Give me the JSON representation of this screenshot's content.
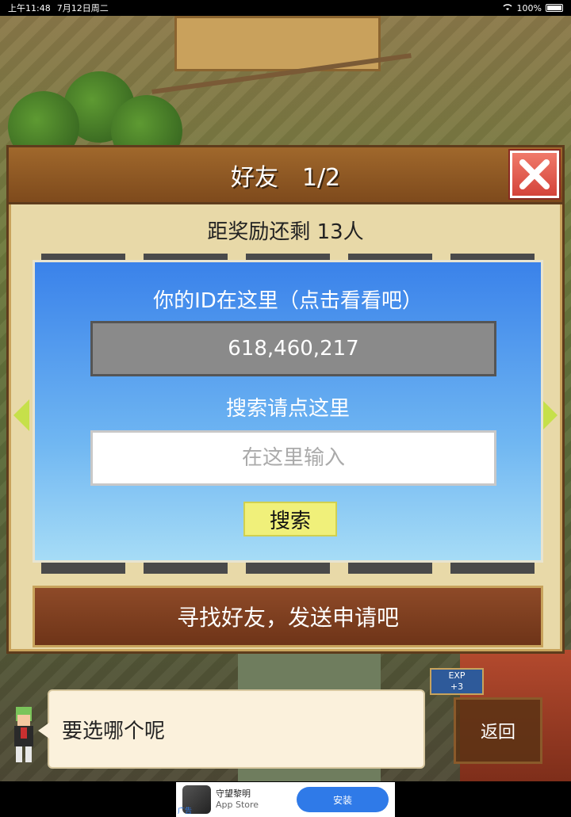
{
  "status_bar": {
    "time": "上午11:48",
    "date": "7月12日周二",
    "battery": "100%"
  },
  "dialog": {
    "title": "好友　1/2",
    "reward_text": "距奖励还剩 13人",
    "id_label": "你的ID在这里（点击看看吧）",
    "id_value": "618,460,217",
    "search_label": "搜索请点这里",
    "search_placeholder": "在这里输入",
    "search_button": "搜索",
    "find_button": "寻找好友，发送申请吧"
  },
  "speech": {
    "text": "要选哪个呢"
  },
  "back_button": "返回",
  "exp_badge": {
    "label": "EXP",
    "value": "+3"
  },
  "ad": {
    "app_name": "守望黎明",
    "store": "App Store",
    "install": "安装",
    "mark": "广告"
  },
  "colors": {
    "panel_blue": "#3a82ea",
    "close_red": "#d4443a",
    "search_yellow": "#f0f07a",
    "arrow_green": "#c6e04a"
  }
}
